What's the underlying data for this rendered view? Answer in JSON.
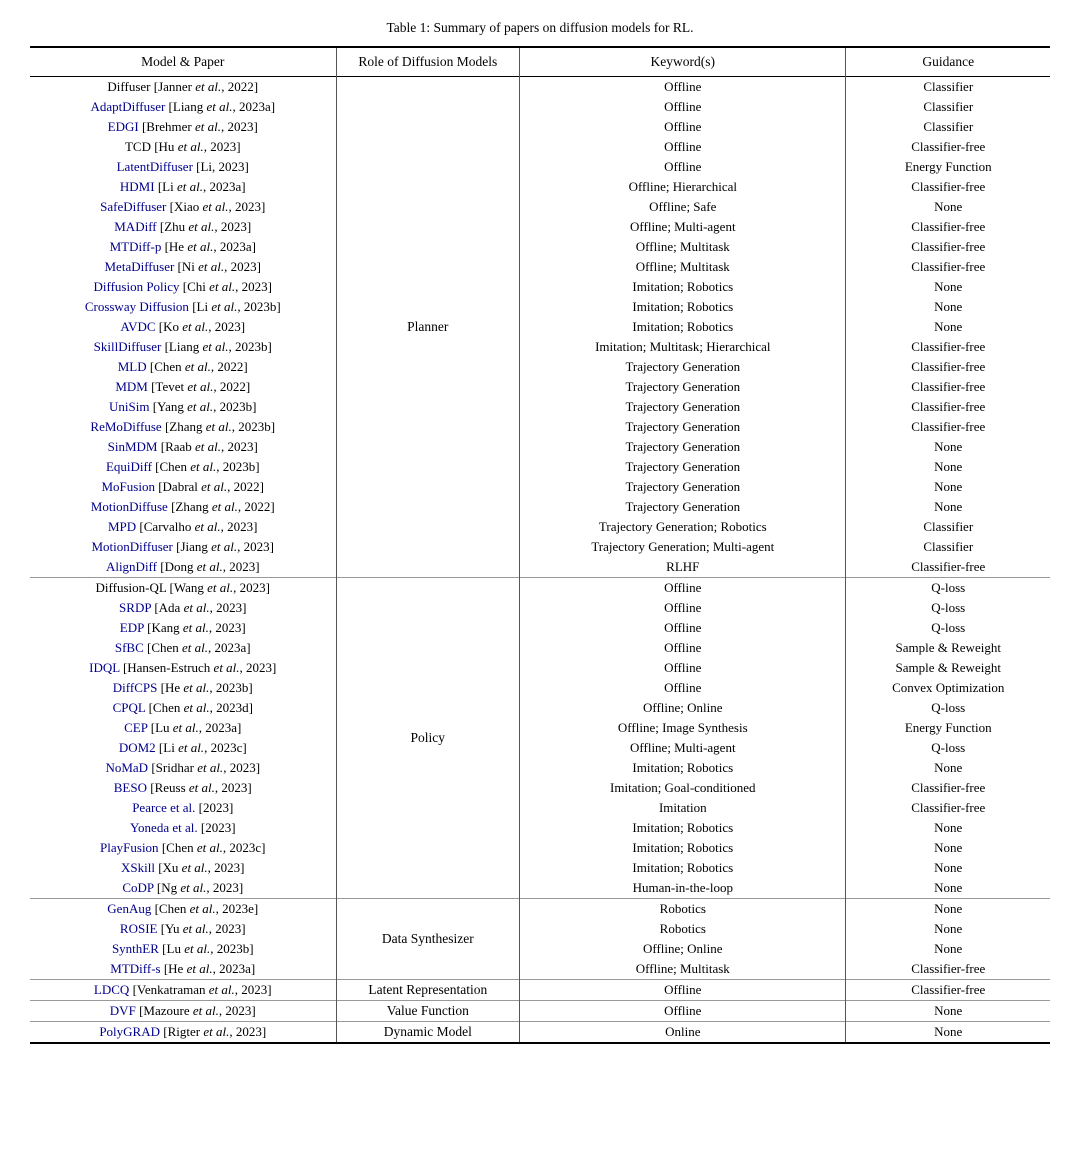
{
  "title": "Table 1: Summary of papers on diffusion models for RL.",
  "headers": {
    "model": "Model & Paper",
    "role": "Role of Diffusion Models",
    "keywords": "Keyword(s)",
    "guidance": "Guidance"
  },
  "groups": [
    {
      "role": "Planner",
      "rows": [
        {
          "model": "Diffuser",
          "cite": "[Janner et al., 2022]",
          "keywords": "Offline",
          "guidance": "Classifier"
        },
        {
          "model": "AdaptDiffuser",
          "cite": "[Liang et al., 2023a]",
          "keywords": "Offline",
          "guidance": "Classifier"
        },
        {
          "model": "EDGI",
          "cite": "[Brehmer et al., 2023]",
          "keywords": "Offline",
          "guidance": "Classifier"
        },
        {
          "model": "TCD",
          "cite": "[Hu et al., 2023]",
          "keywords": "Offline",
          "guidance": "Classifier-free"
        },
        {
          "model": "LatentDiffuser",
          "cite": "[Li, 2023]",
          "keywords": "Offline",
          "guidance": "Energy Function"
        },
        {
          "model": "HDMI",
          "cite": "[Li et al., 2023a]",
          "keywords": "Offline; Hierarchical",
          "guidance": "Classifier-free"
        },
        {
          "model": "SafeDiffuser",
          "cite": "[Xiao et al., 2023]",
          "keywords": "Offline; Safe",
          "guidance": "None"
        },
        {
          "model": "MADiff",
          "cite": "[Zhu et al., 2023]",
          "keywords": "Offline; Multi-agent",
          "guidance": "Classifier-free"
        },
        {
          "model": "MTDiff-p",
          "cite": "[He et al., 2023a]",
          "keywords": "Offline; Multitask",
          "guidance": "Classifier-free"
        },
        {
          "model": "MetaDiffuser",
          "cite": "[Ni et al., 2023]",
          "keywords": "Offline; Multitask",
          "guidance": "Classifier-free"
        },
        {
          "model": "Diffusion Policy",
          "cite": "[Chi et al., 2023]",
          "keywords": "Imitation; Robotics",
          "guidance": "None"
        },
        {
          "model": "Crossway Diffusion",
          "cite": "[Li et al., 2023b]",
          "keywords": "Imitation; Robotics",
          "guidance": "None"
        },
        {
          "model": "AVDC",
          "cite": "[Ko et al., 2023]",
          "keywords": "Imitation; Robotics",
          "guidance": "None"
        },
        {
          "model": "SkillDiffuser",
          "cite": "[Liang et al., 2023b]",
          "keywords": "Imitation; Multitask; Hierarchical",
          "guidance": "Classifier-free"
        },
        {
          "model": "MLD",
          "cite": "[Chen et al., 2022]",
          "keywords": "Trajectory Generation",
          "guidance": "Classifier-free"
        },
        {
          "model": "MDM",
          "cite": "[Tevet et al., 2022]",
          "keywords": "Trajectory Generation",
          "guidance": "Classifier-free"
        },
        {
          "model": "UniSim",
          "cite": "[Yang et al., 2023b]",
          "keywords": "Trajectory Generation",
          "guidance": "Classifier-free"
        },
        {
          "model": "ReMoDiffuse",
          "cite": "[Zhang et al., 2023b]",
          "keywords": "Trajectory Generation",
          "guidance": "Classifier-free"
        },
        {
          "model": "SinMDM",
          "cite": "[Raab et al., 2023]",
          "keywords": "Trajectory Generation",
          "guidance": "None"
        },
        {
          "model": "EquiDiff",
          "cite": "[Chen et al., 2023b]",
          "keywords": "Trajectory Generation",
          "guidance": "None"
        },
        {
          "model": "MoFusion",
          "cite": "[Dabral et al., 2022]",
          "keywords": "Trajectory Generation",
          "guidance": "None"
        },
        {
          "model": "MotionDiffuse",
          "cite": "[Zhang et al., 2022]",
          "keywords": "Trajectory Generation",
          "guidance": "None"
        },
        {
          "model": "MPD",
          "cite": "[Carvalho et al., 2023]",
          "keywords": "Trajectory Generation; Robotics",
          "guidance": "Classifier"
        },
        {
          "model": "MotionDiffuser",
          "cite": "[Jiang et al., 2023]",
          "keywords": "Trajectory Generation; Multi-agent",
          "guidance": "Classifier"
        },
        {
          "model": "AlignDiff",
          "cite": "[Dong et al., 2023]",
          "keywords": "RLHF",
          "guidance": "Classifier-free"
        }
      ]
    },
    {
      "role": "Policy",
      "rows": [
        {
          "model": "Diffusion-QL",
          "cite": "[Wang et al., 2023]",
          "keywords": "Offline",
          "guidance": "Q-loss"
        },
        {
          "model": "SRDP",
          "cite": "[Ada et al., 2023]",
          "keywords": "Offline",
          "guidance": "Q-loss"
        },
        {
          "model": "EDP",
          "cite": "[Kang et al., 2023]",
          "keywords": "Offline",
          "guidance": "Q-loss"
        },
        {
          "model": "SfBC",
          "cite": "[Chen et al., 2023a]",
          "keywords": "Offline",
          "guidance": "Sample & Reweight"
        },
        {
          "model": "IDQL",
          "cite": "[Hansen-Estruch et al., 2023]",
          "keywords": "Offline",
          "guidance": "Sample & Reweight"
        },
        {
          "model": "DiffCPS",
          "cite": "[He et al., 2023b]",
          "keywords": "Offline",
          "guidance": "Convex Optimization"
        },
        {
          "model": "CPQL",
          "cite": "[Chen et al., 2023d]",
          "keywords": "Offline; Online",
          "guidance": "Q-loss"
        },
        {
          "model": "CEP",
          "cite": "[Lu et al., 2023a]",
          "keywords": "Offline; Image Synthesis",
          "guidance": "Energy Function"
        },
        {
          "model": "DOM2",
          "cite": "[Li et al., 2023c]",
          "keywords": "Offline; Multi-agent",
          "guidance": "Q-loss"
        },
        {
          "model": "NoMaD",
          "cite": "[Sridhar et al., 2023]",
          "keywords": "Imitation; Robotics",
          "guidance": "None"
        },
        {
          "model": "BESO",
          "cite": "[Reuss et al., 2023]",
          "keywords": "Imitation; Goal-conditioned",
          "guidance": "Classifier-free"
        },
        {
          "model": "Pearce et al.",
          "cite": " [2023]",
          "keywords": "Imitation",
          "guidance": "Classifier-free"
        },
        {
          "model": "Yoneda et al.",
          "cite": " [2023]",
          "keywords": "Imitation; Robotics",
          "guidance": "None"
        },
        {
          "model": "PlayFusion",
          "cite": "[Chen et al., 2023c]",
          "keywords": "Imitation; Robotics",
          "guidance": "None"
        },
        {
          "model": "XSkill",
          "cite": "[Xu et al., 2023]",
          "keywords": "Imitation; Robotics",
          "guidance": "None"
        },
        {
          "model": "CoDP",
          "cite": "[Ng et al., 2023]",
          "keywords": "Human-in-the-loop",
          "guidance": "None"
        }
      ]
    },
    {
      "role": "Data Synthesizer",
      "rows": [
        {
          "model": "GenAug",
          "cite": "[Chen et al., 2023e]",
          "keywords": "Robotics",
          "guidance": "None"
        },
        {
          "model": "ROSIE",
          "cite": "[Yu et al., 2023]",
          "keywords": "Robotics",
          "guidance": "None"
        },
        {
          "model": "SynthER",
          "cite": "[Lu et al., 2023b]",
          "keywords": "Offline; Online",
          "guidance": "None"
        },
        {
          "model": "MTDiff-s",
          "cite": "[He et al., 2023a]",
          "keywords": "Offline; Multitask",
          "guidance": "Classifier-free"
        }
      ]
    },
    {
      "role": "Latent Representation",
      "rows": [
        {
          "model": "LDCQ",
          "cite": "[Venkatraman et al., 2023]",
          "keywords": "Offline",
          "guidance": "Classifier-free"
        }
      ]
    },
    {
      "role": "Value Function",
      "rows": [
        {
          "model": "DVF",
          "cite": "[Mazoure et al., 2023]",
          "keywords": "Offline",
          "guidance": "None"
        }
      ]
    },
    {
      "role": "Dynamic Model",
      "rows": [
        {
          "model": "PolyGRAD",
          "cite": "[Rigter et al., 2023]",
          "keywords": "Online",
          "guidance": "None"
        }
      ]
    }
  ]
}
